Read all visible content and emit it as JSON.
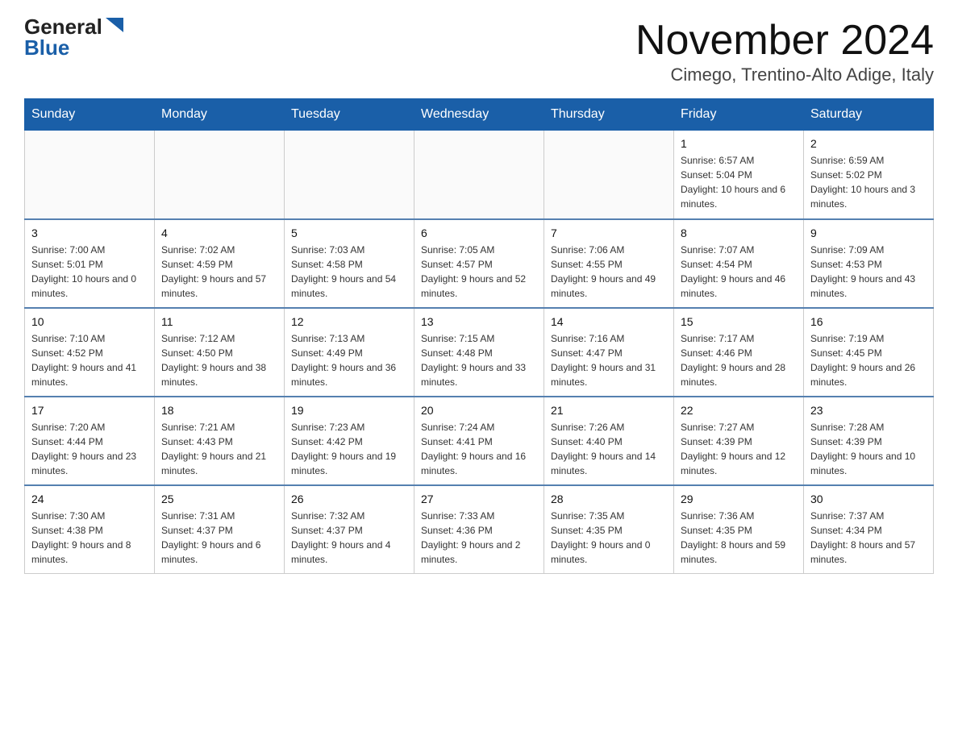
{
  "logo": {
    "general": "General",
    "blue": "Blue"
  },
  "header": {
    "month_title": "November 2024",
    "location": "Cimego, Trentino-Alto Adige, Italy"
  },
  "days_of_week": [
    "Sunday",
    "Monday",
    "Tuesday",
    "Wednesday",
    "Thursday",
    "Friday",
    "Saturday"
  ],
  "weeks": [
    [
      {
        "day": "",
        "info": ""
      },
      {
        "day": "",
        "info": ""
      },
      {
        "day": "",
        "info": ""
      },
      {
        "day": "",
        "info": ""
      },
      {
        "day": "",
        "info": ""
      },
      {
        "day": "1",
        "info": "Sunrise: 6:57 AM\nSunset: 5:04 PM\nDaylight: 10 hours and 6 minutes."
      },
      {
        "day": "2",
        "info": "Sunrise: 6:59 AM\nSunset: 5:02 PM\nDaylight: 10 hours and 3 minutes."
      }
    ],
    [
      {
        "day": "3",
        "info": "Sunrise: 7:00 AM\nSunset: 5:01 PM\nDaylight: 10 hours and 0 minutes."
      },
      {
        "day": "4",
        "info": "Sunrise: 7:02 AM\nSunset: 4:59 PM\nDaylight: 9 hours and 57 minutes."
      },
      {
        "day": "5",
        "info": "Sunrise: 7:03 AM\nSunset: 4:58 PM\nDaylight: 9 hours and 54 minutes."
      },
      {
        "day": "6",
        "info": "Sunrise: 7:05 AM\nSunset: 4:57 PM\nDaylight: 9 hours and 52 minutes."
      },
      {
        "day": "7",
        "info": "Sunrise: 7:06 AM\nSunset: 4:55 PM\nDaylight: 9 hours and 49 minutes."
      },
      {
        "day": "8",
        "info": "Sunrise: 7:07 AM\nSunset: 4:54 PM\nDaylight: 9 hours and 46 minutes."
      },
      {
        "day": "9",
        "info": "Sunrise: 7:09 AM\nSunset: 4:53 PM\nDaylight: 9 hours and 43 minutes."
      }
    ],
    [
      {
        "day": "10",
        "info": "Sunrise: 7:10 AM\nSunset: 4:52 PM\nDaylight: 9 hours and 41 minutes."
      },
      {
        "day": "11",
        "info": "Sunrise: 7:12 AM\nSunset: 4:50 PM\nDaylight: 9 hours and 38 minutes."
      },
      {
        "day": "12",
        "info": "Sunrise: 7:13 AM\nSunset: 4:49 PM\nDaylight: 9 hours and 36 minutes."
      },
      {
        "day": "13",
        "info": "Sunrise: 7:15 AM\nSunset: 4:48 PM\nDaylight: 9 hours and 33 minutes."
      },
      {
        "day": "14",
        "info": "Sunrise: 7:16 AM\nSunset: 4:47 PM\nDaylight: 9 hours and 31 minutes."
      },
      {
        "day": "15",
        "info": "Sunrise: 7:17 AM\nSunset: 4:46 PM\nDaylight: 9 hours and 28 minutes."
      },
      {
        "day": "16",
        "info": "Sunrise: 7:19 AM\nSunset: 4:45 PM\nDaylight: 9 hours and 26 minutes."
      }
    ],
    [
      {
        "day": "17",
        "info": "Sunrise: 7:20 AM\nSunset: 4:44 PM\nDaylight: 9 hours and 23 minutes."
      },
      {
        "day": "18",
        "info": "Sunrise: 7:21 AM\nSunset: 4:43 PM\nDaylight: 9 hours and 21 minutes."
      },
      {
        "day": "19",
        "info": "Sunrise: 7:23 AM\nSunset: 4:42 PM\nDaylight: 9 hours and 19 minutes."
      },
      {
        "day": "20",
        "info": "Sunrise: 7:24 AM\nSunset: 4:41 PM\nDaylight: 9 hours and 16 minutes."
      },
      {
        "day": "21",
        "info": "Sunrise: 7:26 AM\nSunset: 4:40 PM\nDaylight: 9 hours and 14 minutes."
      },
      {
        "day": "22",
        "info": "Sunrise: 7:27 AM\nSunset: 4:39 PM\nDaylight: 9 hours and 12 minutes."
      },
      {
        "day": "23",
        "info": "Sunrise: 7:28 AM\nSunset: 4:39 PM\nDaylight: 9 hours and 10 minutes."
      }
    ],
    [
      {
        "day": "24",
        "info": "Sunrise: 7:30 AM\nSunset: 4:38 PM\nDaylight: 9 hours and 8 minutes."
      },
      {
        "day": "25",
        "info": "Sunrise: 7:31 AM\nSunset: 4:37 PM\nDaylight: 9 hours and 6 minutes."
      },
      {
        "day": "26",
        "info": "Sunrise: 7:32 AM\nSunset: 4:37 PM\nDaylight: 9 hours and 4 minutes."
      },
      {
        "day": "27",
        "info": "Sunrise: 7:33 AM\nSunset: 4:36 PM\nDaylight: 9 hours and 2 minutes."
      },
      {
        "day": "28",
        "info": "Sunrise: 7:35 AM\nSunset: 4:35 PM\nDaylight: 9 hours and 0 minutes."
      },
      {
        "day": "29",
        "info": "Sunrise: 7:36 AM\nSunset: 4:35 PM\nDaylight: 8 hours and 59 minutes."
      },
      {
        "day": "30",
        "info": "Sunrise: 7:37 AM\nSunset: 4:34 PM\nDaylight: 8 hours and 57 minutes."
      }
    ]
  ]
}
